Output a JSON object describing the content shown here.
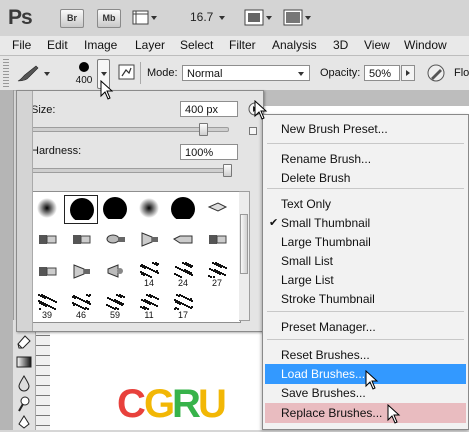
{
  "appbar": {
    "logo": "Ps",
    "bridge_label": "Br",
    "minibridge_label": "Mb",
    "zoom_level": "16.7"
  },
  "menubar": {
    "items": [
      "File",
      "Edit",
      "Image",
      "Layer",
      "Select",
      "Filter",
      "Analysis",
      "3D",
      "View",
      "Window"
    ]
  },
  "options": {
    "brush_size_label": "400",
    "mode_label": "Mode:",
    "mode_value": "Normal",
    "opacity_label": "Opacity:",
    "opacity_value": "50%",
    "flow_label": "Flo"
  },
  "brush_panel": {
    "size_label": "Size:",
    "size_value": "400 px",
    "size_level": 0.88,
    "hardness_label": "Hardness:",
    "hardness_value": "100%",
    "hardness_level": 1.0,
    "brushes": [
      {
        "icon": "soft-round-brush",
        "num": ""
      },
      {
        "icon": "hard-round-brush",
        "num": ""
      },
      {
        "icon": "hard-round-brush",
        "num": ""
      },
      {
        "icon": "soft-round-brush",
        "num": ""
      },
      {
        "icon": "hard-round-brush",
        "num": ""
      },
      {
        "icon": "pen-tip-brush",
        "num": ""
      },
      {
        "icon": "flat-brush",
        "num": ""
      },
      {
        "icon": "flat-brush",
        "num": ""
      },
      {
        "icon": "round-bristle-brush",
        "num": ""
      },
      {
        "icon": "fan-brush",
        "num": ""
      },
      {
        "icon": "pencil-tip-brush",
        "num": ""
      },
      {
        "icon": "flat-brush",
        "num": ""
      },
      {
        "icon": "flat-brush",
        "num": ""
      },
      {
        "icon": "fan-brush",
        "num": ""
      },
      {
        "icon": "airbrush-brush",
        "num": ""
      },
      {
        "icon": "scatter-brush",
        "num": "14"
      },
      {
        "icon": "scatter-brush",
        "num": "24"
      },
      {
        "icon": "scatter-brush",
        "num": "27"
      },
      {
        "icon": "scatter-brush",
        "num": "39"
      },
      {
        "icon": "scatter-brush",
        "num": "46"
      },
      {
        "icon": "scatter-brush",
        "num": "59"
      },
      {
        "icon": "scatter-brush",
        "num": "11"
      },
      {
        "icon": "scatter-brush",
        "num": "17"
      }
    ]
  },
  "context_menu": {
    "items": [
      {
        "label": "New Brush Preset...",
        "checked": false,
        "highlight": ""
      },
      {
        "label": "Rename Brush...",
        "checked": false,
        "highlight": ""
      },
      {
        "label": "Delete Brush",
        "checked": false,
        "highlight": ""
      },
      {
        "label": "Text Only",
        "checked": false,
        "highlight": ""
      },
      {
        "label": "Small Thumbnail",
        "checked": true,
        "highlight": ""
      },
      {
        "label": "Large Thumbnail",
        "checked": false,
        "highlight": ""
      },
      {
        "label": "Small List",
        "checked": false,
        "highlight": ""
      },
      {
        "label": "Large List",
        "checked": false,
        "highlight": ""
      },
      {
        "label": "Stroke Thumbnail",
        "checked": false,
        "highlight": ""
      },
      {
        "label": "Preset Manager...",
        "checked": false,
        "highlight": ""
      },
      {
        "label": "Reset Brushes...",
        "checked": false,
        "highlight": ""
      },
      {
        "label": "Load Brushes...",
        "checked": false,
        "highlight": "blue"
      },
      {
        "label": "Save Brushes...",
        "checked": false,
        "highlight": ""
      },
      {
        "label": "Replace Brushes...",
        "checked": false,
        "highlight": "pink"
      }
    ]
  },
  "canvas": {
    "logo_letters": [
      {
        "ch": "C",
        "color": "#e8413c"
      },
      {
        "ch": "G",
        "color": "#f2b705"
      },
      {
        "ch": "R",
        "color": "#37b34a"
      },
      {
        "ch": "U",
        "color": "#f2b705"
      }
    ]
  },
  "colors": {
    "menu_highlight": "#3399ff",
    "menu_highlight_alt": "#e9bcc0"
  }
}
